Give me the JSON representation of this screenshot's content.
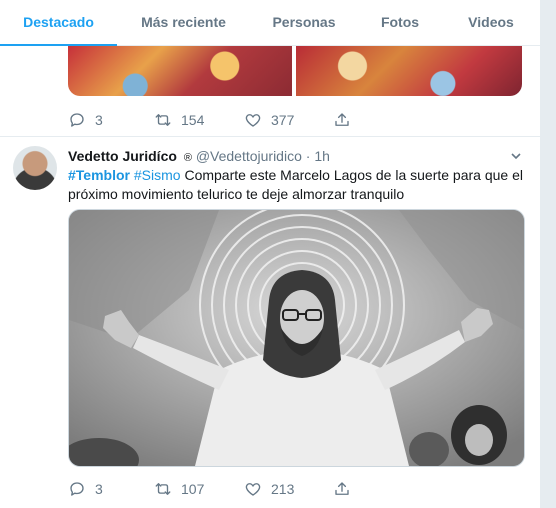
{
  "tabs": [
    "Destacado",
    "Más reciente",
    "Personas",
    "Fotos",
    "Videos"
  ],
  "tweet1": {
    "replies": "3",
    "retweets": "154",
    "likes": "377"
  },
  "tweet2": {
    "name": "Vedetto Juridíco",
    "badge": "®",
    "handle": "@Vedettojuridico",
    "dot": "·",
    "time": "1h",
    "hashtag1": "#Temblor",
    "hashtag2": "#Sismo",
    "text": " Comparte este Marcelo Lagos de la suerte para que el próximo movimiento telurico te deje almorzar tranquilo",
    "replies": "3",
    "retweets": "107",
    "likes": "213"
  },
  "icons": {
    "reply": "reply-icon",
    "retweet": "retweet-icon",
    "like": "heart-icon",
    "share": "share-icon",
    "more": "chevron-down-icon"
  },
  "colors": {
    "accent": "#1da1f2",
    "link": "#1b95e0",
    "muted": "#657786",
    "background": "#e6ecf0"
  }
}
